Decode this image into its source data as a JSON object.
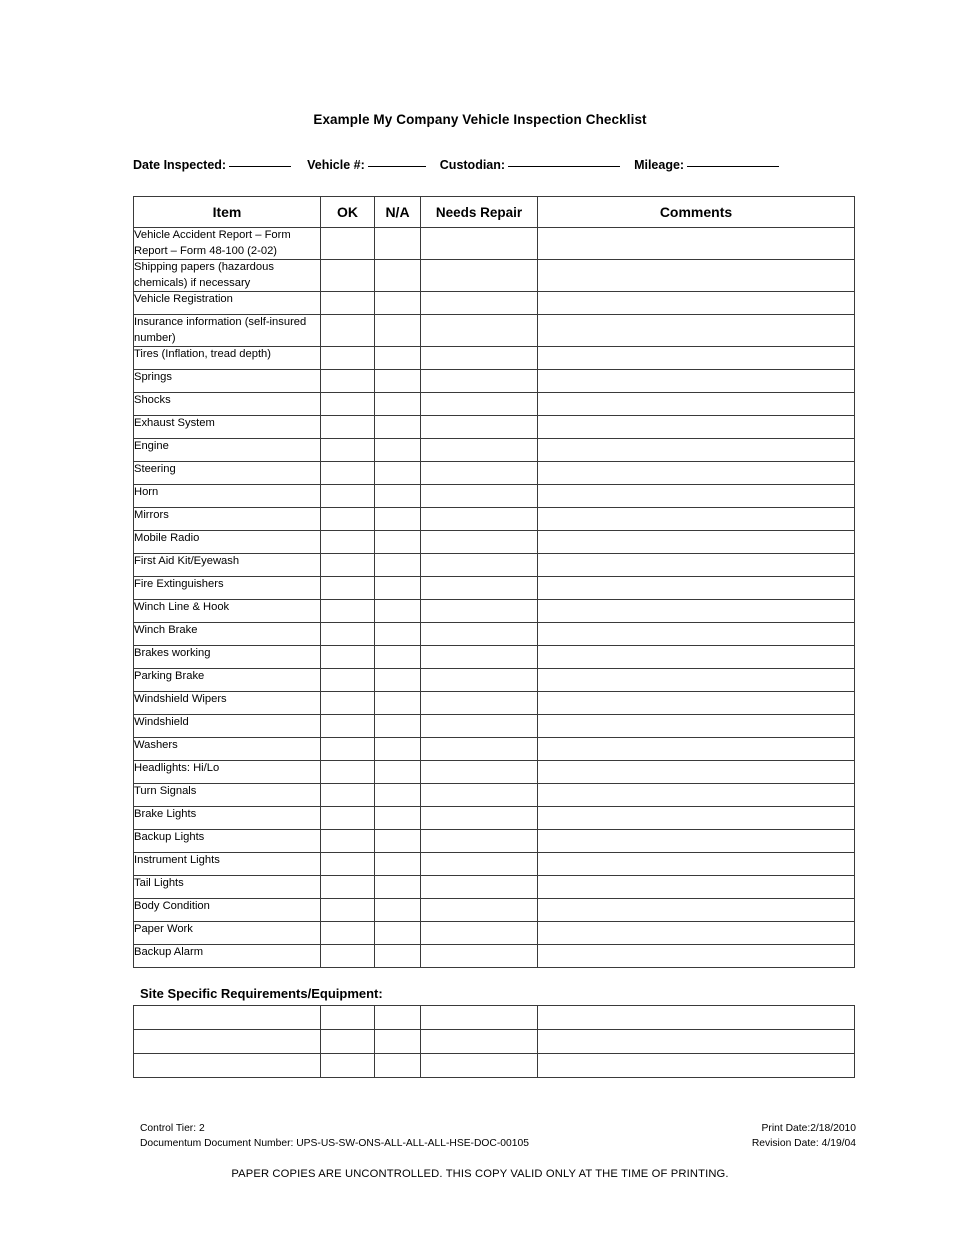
{
  "document": {
    "title": "Example My Company Vehicle Inspection Checklist"
  },
  "form_fields": [
    {
      "label": "Date Inspected:",
      "value": "",
      "rule": "sm"
    },
    {
      "label": "Vehicle #:",
      "value": "",
      "rule": "md"
    },
    {
      "label": "Custodian:",
      "value": "",
      "rule": "lg"
    },
    {
      "label": "Mileage:",
      "value": "",
      "rule": "xl"
    }
  ],
  "table": {
    "columns": [
      "Item",
      "OK",
      "N/A",
      "Needs Repair",
      "Comments"
    ],
    "rows": [
      {
        "item": "Vehicle Accident Report – Form  Report – Form 48-100 (2-02)",
        "ok": "",
        "na": "",
        "needs_repair": "",
        "comments": "",
        "lines": 3
      },
      {
        "item": "Shipping papers (hazardous chemicals) if necessary",
        "ok": "",
        "na": "",
        "needs_repair": "",
        "comments": "",
        "lines": 2
      },
      {
        "item": "Vehicle Registration",
        "ok": "",
        "na": "",
        "needs_repair": "",
        "comments": "",
        "lines": 1
      },
      {
        "item": "Insurance information (self-insured number)",
        "ok": "",
        "na": "",
        "needs_repair": "",
        "comments": "",
        "lines": 2
      },
      {
        "item": "Tires (Inflation, tread depth)",
        "ok": "",
        "na": "",
        "needs_repair": "",
        "comments": "",
        "lines": 1
      },
      {
        "item": "Springs",
        "ok": "",
        "na": "",
        "needs_repair": "",
        "comments": "",
        "lines": 1
      },
      {
        "item": "Shocks",
        "ok": "",
        "na": "",
        "needs_repair": "",
        "comments": "",
        "lines": 1
      },
      {
        "item": "Exhaust System",
        "ok": "",
        "na": "",
        "needs_repair": "",
        "comments": "",
        "lines": 1
      },
      {
        "item": "Engine",
        "ok": "",
        "na": "",
        "needs_repair": "",
        "comments": "",
        "lines": 1
      },
      {
        "item": "Steering",
        "ok": "",
        "na": "",
        "needs_repair": "",
        "comments": "",
        "lines": 1
      },
      {
        "item": "Horn",
        "ok": "",
        "na": "",
        "needs_repair": "",
        "comments": "",
        "lines": 1
      },
      {
        "item": "Mirrors",
        "ok": "",
        "na": "",
        "needs_repair": "",
        "comments": "",
        "lines": 1
      },
      {
        "item": "Mobile Radio",
        "ok": "",
        "na": "",
        "needs_repair": "",
        "comments": "",
        "lines": 1
      },
      {
        "item": "First Aid Kit/Eyewash",
        "ok": "",
        "na": "",
        "needs_repair": "",
        "comments": "",
        "lines": 1
      },
      {
        "item": "Fire Extinguishers",
        "ok": "",
        "na": "",
        "needs_repair": "",
        "comments": "",
        "lines": 1
      },
      {
        "item": "Winch Line & Hook",
        "ok": "",
        "na": "",
        "needs_repair": "",
        "comments": "",
        "lines": 1
      },
      {
        "item": "Winch Brake",
        "ok": "",
        "na": "",
        "needs_repair": "",
        "comments": "",
        "lines": 1
      },
      {
        "item": "Brakes working",
        "ok": "",
        "na": "",
        "needs_repair": "",
        "comments": "",
        "lines": 1
      },
      {
        "item": "Parking Brake",
        "ok": "",
        "na": "",
        "needs_repair": "",
        "comments": "",
        "lines": 1
      },
      {
        "item": "Windshield Wipers",
        "ok": "",
        "na": "",
        "needs_repair": "",
        "comments": "",
        "lines": 1
      },
      {
        "item": "Windshield",
        "ok": "",
        "na": "",
        "needs_repair": "",
        "comments": "",
        "lines": 1
      },
      {
        "item": "Washers",
        "ok": "",
        "na": "",
        "needs_repair": "",
        "comments": "",
        "lines": 1
      },
      {
        "item": "Headlights: Hi/Lo",
        "ok": "",
        "na": "",
        "needs_repair": "",
        "comments": "",
        "lines": 1
      },
      {
        "item": "Turn Signals",
        "ok": "",
        "na": "",
        "needs_repair": "",
        "comments": "",
        "lines": 1
      },
      {
        "item": "Brake Lights",
        "ok": "",
        "na": "",
        "needs_repair": "",
        "comments": "",
        "lines": 1
      },
      {
        "item": "Backup Lights",
        "ok": "",
        "na": "",
        "needs_repair": "",
        "comments": "",
        "lines": 1
      },
      {
        "item": "Instrument Lights",
        "ok": "",
        "na": "",
        "needs_repair": "",
        "comments": "",
        "lines": 1
      },
      {
        "item": "Tail Lights",
        "ok": "",
        "na": "",
        "needs_repair": "",
        "comments": "",
        "lines": 1
      },
      {
        "item": "Body Condition",
        "ok": "",
        "na": "",
        "needs_repair": "",
        "comments": "",
        "lines": 1
      },
      {
        "item": "Paper Work",
        "ok": "",
        "na": "",
        "needs_repair": "",
        "comments": "",
        "lines": 1
      },
      {
        "item": "Backup Alarm",
        "ok": "",
        "na": "",
        "needs_repair": "",
        "comments": "",
        "lines": 1
      }
    ]
  },
  "site_specific": {
    "heading": "Site Specific Requirements/Equipment:",
    "rows": [
      {
        "item": "",
        "ok": "",
        "na": "",
        "needs_repair": "",
        "comments": ""
      },
      {
        "item": "",
        "ok": "",
        "na": "",
        "needs_repair": "",
        "comments": ""
      },
      {
        "item": "",
        "ok": "",
        "na": "",
        "needs_repair": "",
        "comments": ""
      }
    ]
  },
  "footer": {
    "control_tier": "Control Tier: 2",
    "document_number": "Documentum Document Number: UPS-US-SW-ONS-ALL-ALL-ALL-HSE-DOC-00105",
    "print_date": "Print Date:2/18/2010",
    "revision_date": "Revision Date: 4/19/04",
    "disclaimer": "PAPER COPIES ARE UNCONTROLLED.  THIS COPY VALID ONLY AT THE TIME OF PRINTING."
  }
}
